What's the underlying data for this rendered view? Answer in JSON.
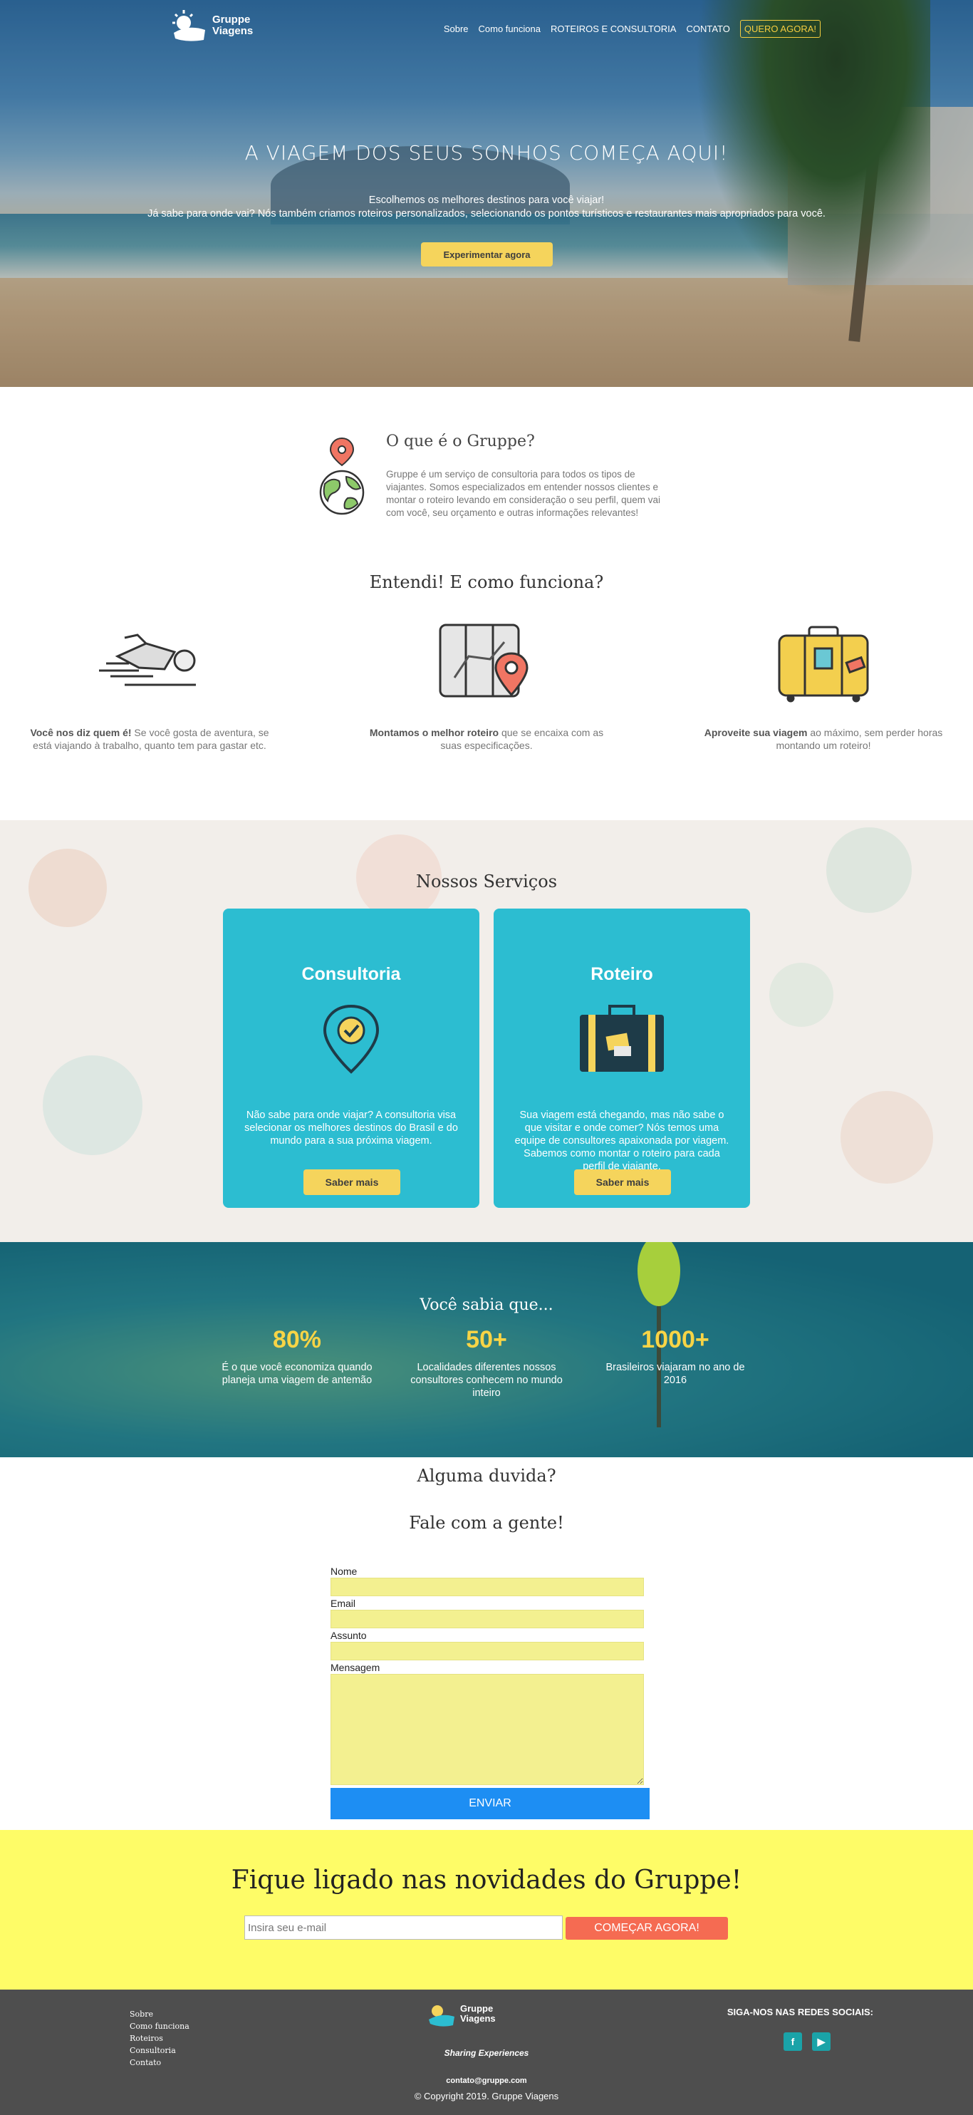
{
  "header": {
    "brand_line1": "Gruppe",
    "brand_line2": "Viagens",
    "nav": [
      "Sobre",
      "Como funciona",
      "Roteiros e consultoria",
      "Contato",
      "Quero agora!"
    ]
  },
  "hero": {
    "title": "A VIAGEM DOS SEUS SONHOS COMEÇA AQUI!",
    "line1": "Escolhemos os melhores destinos para você viajar!",
    "line2": "Já sabe para onde vai? Nós também criamos roteiros personalizados, selecionando os pontos turísticos e restaurantes mais apropriados para você.",
    "button": "Experimentar agora"
  },
  "about": {
    "title": "O que é o Gruppe?",
    "text": "Gruppe é um serviço de consultoria para todos os tipos de viajantes. Somos especializados em entender nossos clientes e montar o roteiro levando em consideração o seu perfil, quem vai com você, seu orçamento e outras informações relevantes!"
  },
  "how": {
    "title": "Entendi! E como funciona?",
    "steps": [
      {
        "bold": "Você nos diz quem é!",
        "text": " Se você gosta de aventura, se está viajando à trabalho, quanto tem para gastar etc."
      },
      {
        "bold": "Montamos o melhor roteiro",
        "text": " que se encaixa com as suas especificações."
      },
      {
        "bold": "Aproveite sua viagem",
        "text": " ao máximo, sem perder horas montando um roteiro!"
      }
    ]
  },
  "services": {
    "title": "Nossos Serviços",
    "cards": [
      {
        "title": "Consultoria",
        "text": "Não sabe para onde viajar? A consultoria visa selecionar os melhores destinos do Brasil e do mundo para a sua próxima viagem.",
        "button": "Saber mais"
      },
      {
        "title": "Roteiro",
        "text": "Sua viagem está chegando, mas não sabe o que visitar e onde comer? Nós temos uma equipe de consultores apaixonada por viagem. Sabemos como montar o roteiro para cada perfil de viajante.",
        "button": "Saber mais"
      }
    ]
  },
  "stats": {
    "title": "Você sabia que...",
    "items": [
      {
        "num": "80%",
        "label": "É o que você economiza quando planeja uma viagem de antemão"
      },
      {
        "num": "50+",
        "label": "Localidades diferentes nossos consultores conhecem no mundo inteiro"
      },
      {
        "num": "1000+",
        "label": "Brasileiros viajaram no ano de 2016"
      }
    ]
  },
  "contact": {
    "question": "Alguma duvida?",
    "title": "Fale com a gente!",
    "labels": {
      "name": "Nome",
      "email": "Email",
      "subject": "Assunto",
      "message": "Mensagem"
    },
    "submit": "ENVIAR"
  },
  "newsletter": {
    "title": "Fique ligado nas novidades do Gruppe!",
    "placeholder": "Insira seu e-mail",
    "button": "COMEÇAR AGORA!"
  },
  "footer": {
    "links": [
      "Sobre",
      "Como funciona",
      "Roteiros",
      "Consultoria",
      "Contato"
    ],
    "slogan": "Sharing Experiences",
    "email": "contato@gruppe.com",
    "copyright": "© Copyright 2019. Gruppe Viagens",
    "social_title": "SIGA-NOS NAS REDES SOCIAIS:",
    "social": [
      "facebook-icon",
      "youtube-icon"
    ]
  },
  "colors": {
    "accent": "#f5d45c",
    "teal": "#2cbdd1",
    "blue": "#1d8ef3",
    "coral": "#f56b52",
    "news_bg": "#fefc67",
    "footer_bg": "#4e4e4e"
  }
}
